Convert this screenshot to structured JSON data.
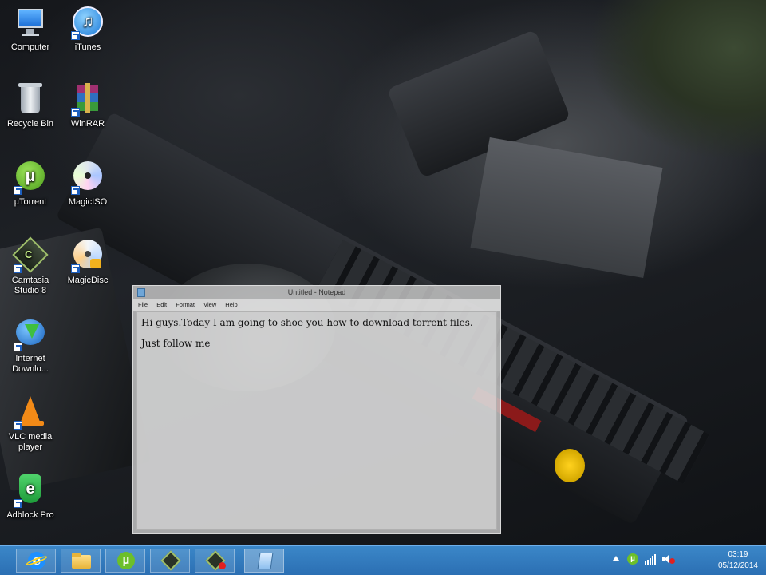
{
  "desktop": {
    "icons": [
      {
        "label": "Computer"
      },
      {
        "label": "iTunes"
      },
      {
        "label": "Recycle Bin"
      },
      {
        "label": "WinRAR"
      },
      {
        "label": "µTorrent"
      },
      {
        "label": "MagicISO"
      },
      {
        "label": "Camtasia Studio 8"
      },
      {
        "label": "MagicDisc"
      },
      {
        "label": "Internet Downlo..."
      },
      {
        "label": "VLC media player"
      },
      {
        "label": "Adblock Pro"
      }
    ]
  },
  "notepad": {
    "title": "Untitled - Notepad",
    "menu": [
      "File",
      "Edit",
      "Format",
      "View",
      "Help"
    ],
    "lines": [
      "Hi guys.Today I am going to shoe you how to download torrent files.",
      "Just follow me"
    ]
  },
  "taskbar": {
    "pinned": [
      {
        "icon": "internet-explorer-icon"
      },
      {
        "icon": "file-explorer-icon"
      },
      {
        "icon": "utorrent-icon"
      },
      {
        "icon": "camtasia-icon"
      },
      {
        "icon": "camtasia-recorder-icon"
      },
      {
        "icon": "notepad-icon"
      }
    ],
    "clock_time": "03:19",
    "clock_date": "05/12/2014"
  },
  "colors": {
    "taskbar": "#2f78bd",
    "utorrent": "#6cbf2a",
    "ie": "#1e90ff"
  }
}
